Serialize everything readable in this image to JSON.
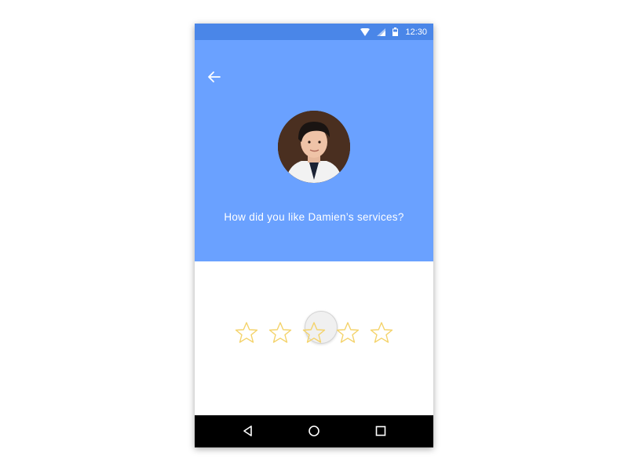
{
  "status_bar": {
    "time": "12:30",
    "icons": [
      "wifi-icon",
      "signal-icon",
      "battery-icon"
    ]
  },
  "header": {
    "back_icon": "arrow-left-icon",
    "avatar": "profile-photo",
    "question": "How did you like Damien’s services?"
  },
  "rating": {
    "max": 5,
    "value": 0,
    "star_icon": "star-outline-icon"
  },
  "nav_bar": {
    "buttons": [
      "back-triangle-icon",
      "home-circle-icon",
      "recents-square-icon"
    ]
  },
  "colors": {
    "status_bar": "#4a86e8",
    "header": "#6aa1ff",
    "star_outline": "#f4d36b",
    "nav_bar": "#000000"
  }
}
